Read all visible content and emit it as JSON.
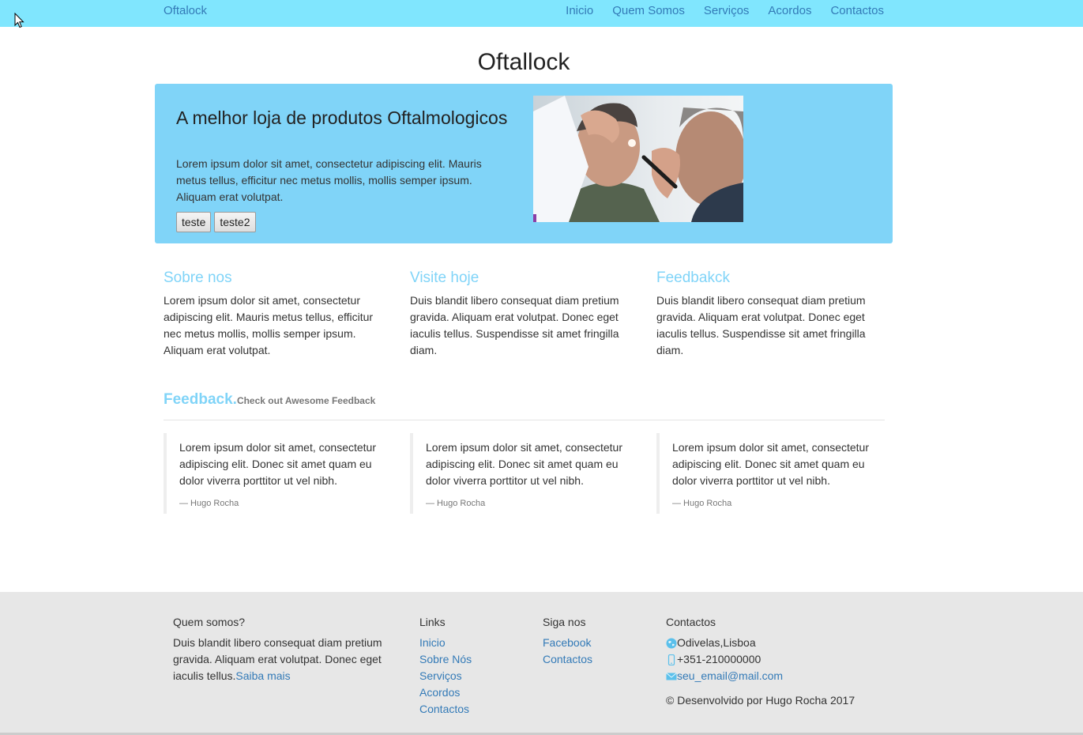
{
  "navbar": {
    "brand": "Oftalock",
    "items": [
      "Inicio",
      "Quem Somos",
      "Serviços",
      "Acordos",
      "Contactos"
    ]
  },
  "site_title": "Oftallock",
  "jumbotron": {
    "heading": "A melhor loja de produtos Oftalmologicos",
    "text": "Lorem ipsum dolor sit amet, consectetur adipiscing elit. Mauris metus tellus, efficitur nec metus mollis, mollis semper ipsum. Aliquam erat volutpat.",
    "buttons": [
      "teste",
      "teste2"
    ],
    "image": "eye-exam-photo"
  },
  "columns": [
    {
      "title": "Sobre nos",
      "text": "Lorem ipsum dolor sit amet, consectetur adipiscing elit. Mauris metus tellus, efficitur nec metus mollis, mollis semper ipsum. Aliquam erat volutpat."
    },
    {
      "title": "Visite hoje",
      "text": "Duis blandit libero consequat diam pretium gravida. Aliquam erat volutpat. Donec eget iaculis tellus. Suspendisse sit amet fringilla diam."
    },
    {
      "title": "Feedbakck",
      "text": "Duis blandit libero consequat diam pretium gravida. Aliquam erat volutpat. Donec eget iaculis tellus. Suspendisse sit amet fringilla diam."
    }
  ],
  "feedback": {
    "title": "Feedback.",
    "subtitle": "Check out Awesome Feedback",
    "quotes": [
      {
        "text": "Lorem ipsum dolor sit amet, consectetur adipiscing elit. Donec sit amet quam eu dolor viverra porttitor ut vel nibh.",
        "author": "— Hugo Rocha"
      },
      {
        "text": "Lorem ipsum dolor sit amet, consectetur adipiscing elit. Donec sit amet quam eu dolor viverra porttitor ut vel nibh.",
        "author": "— Hugo Rocha"
      },
      {
        "text": "Lorem ipsum dolor sit amet, consectetur adipiscing elit. Donec sit amet quam eu dolor viverra porttitor ut vel nibh.",
        "author": "— Hugo Rocha"
      }
    ]
  },
  "footer": {
    "about": {
      "title": "Quem somos?",
      "text": "Duis blandit libero consequat diam pretium gravida. Aliquam erat volutpat. Donec eget iaculis tellus.",
      "link": "Saiba mais"
    },
    "links": {
      "title": "Links",
      "items": [
        "Inicio",
        "Sobre Nós",
        "Serviços",
        "Acordos",
        "Contactos"
      ]
    },
    "social": {
      "title": "Siga nos",
      "items": [
        "Facebook",
        "Contactos"
      ]
    },
    "contacts": {
      "title": "Contactos",
      "location": "Odivelas,Lisboa",
      "phone": "+351-210000000",
      "email": "seu_email@mail.com",
      "icons": [
        "globe-icon",
        "phone-icon",
        "envelope-icon"
      ],
      "copyright": "© Desenvolvido por Hugo Rocha 2017"
    }
  },
  "colors": {
    "navbar": "#80e6fe",
    "jumbotron": "#80d4f8",
    "accent_heading": "#80d4f8",
    "link": "#337ab7",
    "footer": "#e7e7e7"
  }
}
